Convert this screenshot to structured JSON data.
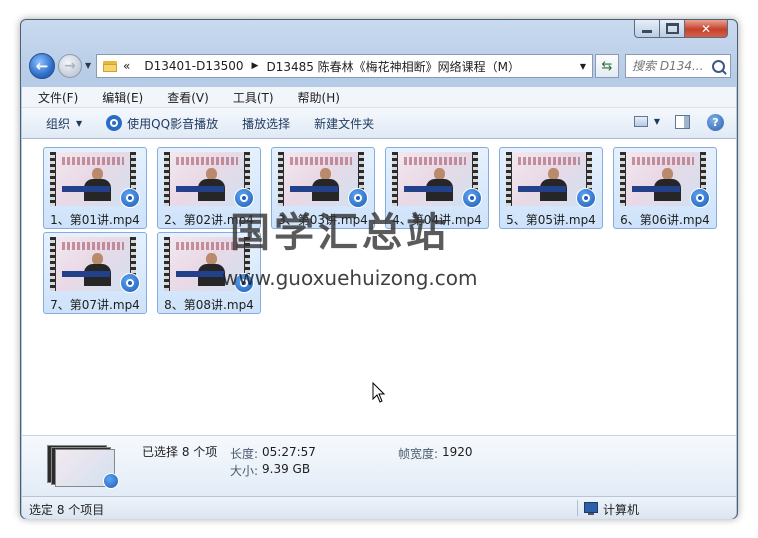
{
  "window": {
    "address": {
      "overflow": "«",
      "crumbs": [
        "D13401-D13500",
        "D13485 陈春林《梅花神相断》网络课程（M）"
      ]
    },
    "search": {
      "placeholder": "搜索 D134..."
    }
  },
  "menu": [
    "文件(F)",
    "编辑(E)",
    "查看(V)",
    "工具(T)",
    "帮助(H)"
  ],
  "toolbar": {
    "organize": "组织",
    "play_qq": "使用QQ影音播放",
    "play_select": "播放选择",
    "new_folder": "新建文件夹"
  },
  "files": [
    "1、第01讲.mp4",
    "2、第02讲.mp4",
    "3、第03讲.mp4",
    "4、第04讲.mp4",
    "5、第05讲.mp4",
    "6、第06讲.mp4",
    "7、第07讲.mp4",
    "8、第08讲.mp4"
  ],
  "watermark": {
    "title": "国学汇总站",
    "url": "www.guoxuehuizong.com"
  },
  "details": {
    "selected": "已选择 8 个项",
    "length_label": "长度:",
    "length_value": "05:27:57",
    "size_label": "大小:",
    "size_value": "9.39 GB",
    "frame_width_label": "帧宽度:",
    "frame_width_value": "1920"
  },
  "status": {
    "left": "选定 8 个项目",
    "right": "计算机"
  },
  "colors": {
    "selection_fill": "#cde2fa",
    "selection_border": "#84acdd",
    "close_button": "#c5422b",
    "frame": "#b6cbe6"
  }
}
